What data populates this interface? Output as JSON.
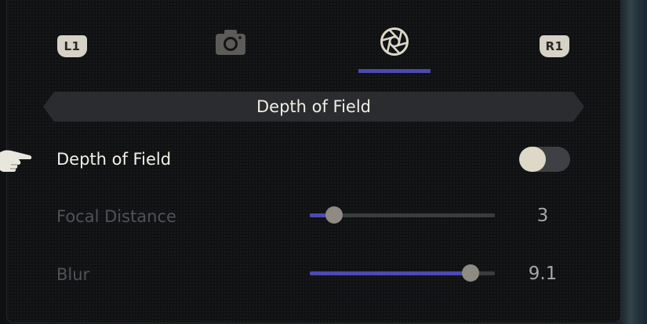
{
  "tabs": {
    "left_button": "L1",
    "right_button": "R1",
    "items": [
      {
        "icon": "camera-icon",
        "active": false
      },
      {
        "icon": "aperture-icon",
        "active": true
      }
    ]
  },
  "section": {
    "title": "Depth of Field"
  },
  "settings": {
    "depth_of_field": {
      "label": "Depth of Field",
      "enabled": true,
      "toggle_state": "on"
    },
    "focal_distance": {
      "label": "Focal Distance",
      "value": "3",
      "fill_fraction": 0.13
    },
    "blur": {
      "label": "Blur",
      "value": "9.1",
      "fill_fraction": 0.87
    }
  },
  "colors": {
    "accent": "#4c49b0",
    "text_active": "#f3f0e6",
    "text_dim": "#4f5256",
    "badge": "#d6d2c6"
  }
}
